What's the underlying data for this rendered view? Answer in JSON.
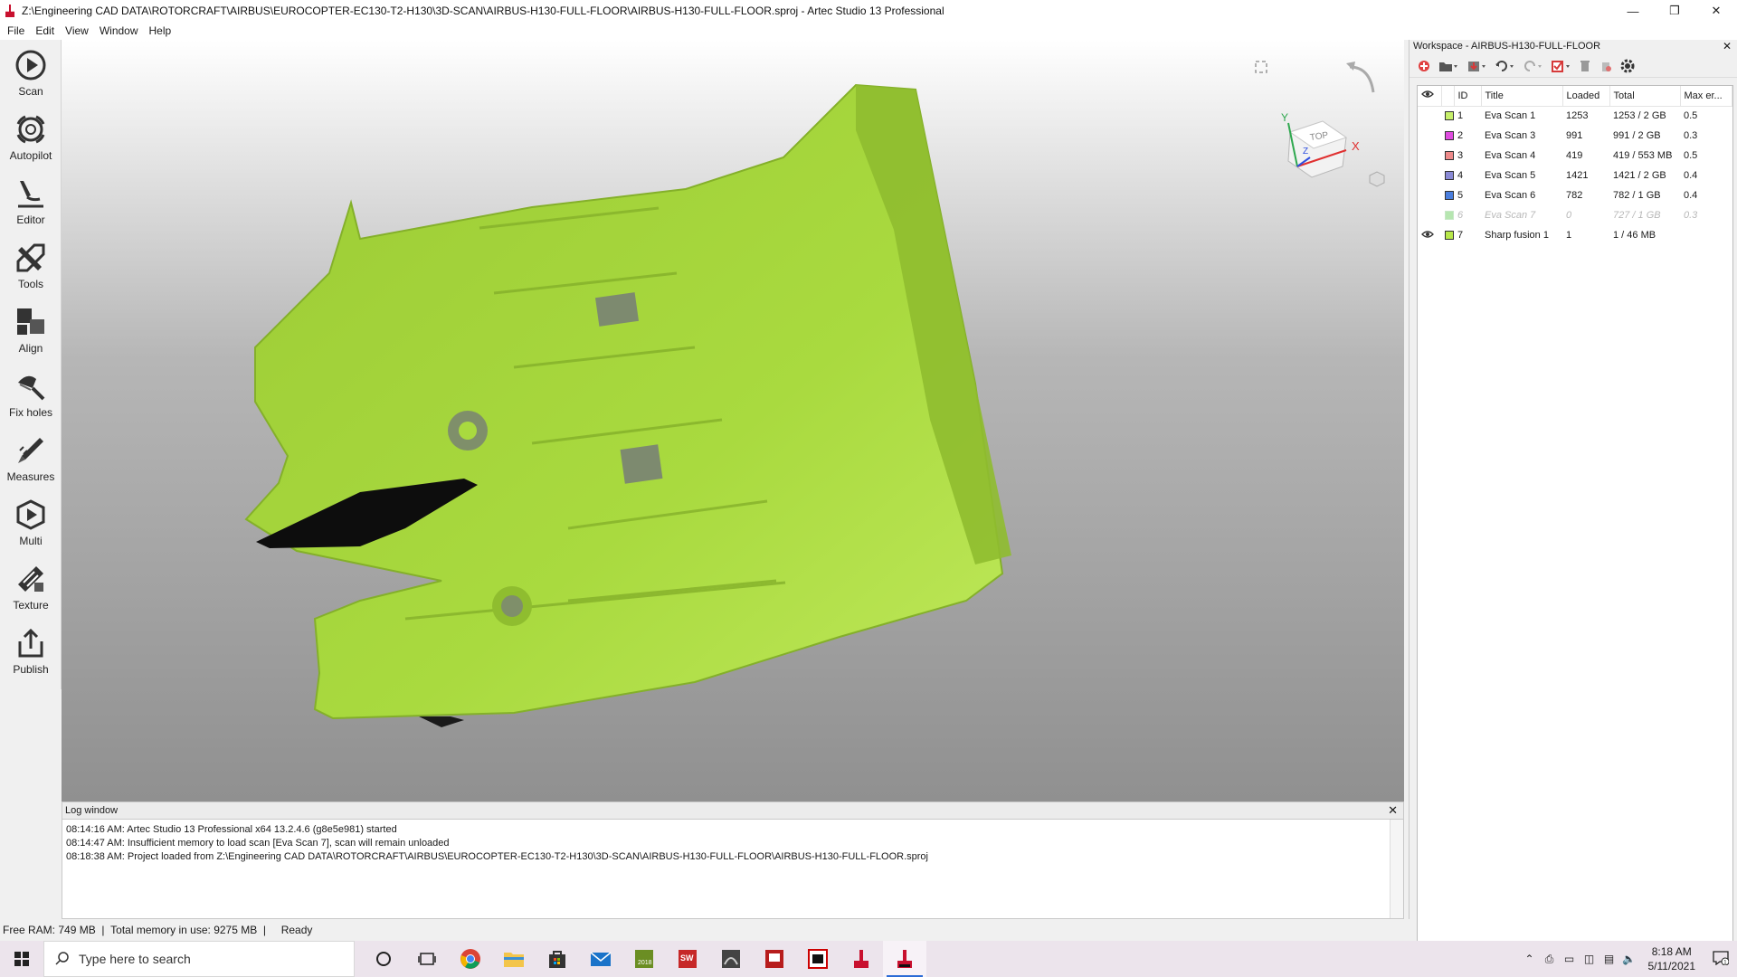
{
  "window": {
    "title": "Z:\\Engineering CAD DATA\\ROTORCRAFT\\AIRBUS\\EUROCOPTER-EC130-T2-H130\\3D-SCAN\\AIRBUS-H130-FULL-FLOOR\\AIRBUS-H130-FULL-FLOOR.sproj - Artec Studio 13 Professional"
  },
  "menu": {
    "items": [
      "File",
      "Edit",
      "View",
      "Window",
      "Help"
    ]
  },
  "toolbar": {
    "tools": [
      {
        "label": "Scan",
        "icon": "scan-icon"
      },
      {
        "label": "Autopilot",
        "icon": "autopilot-icon"
      },
      {
        "label": "Editor",
        "icon": "editor-icon"
      },
      {
        "label": "Tools",
        "icon": "tools-icon"
      },
      {
        "label": "Align",
        "icon": "align-icon"
      },
      {
        "label": "Fix holes",
        "icon": "fix-holes-icon"
      },
      {
        "label": "Measures",
        "icon": "measures-icon"
      },
      {
        "label": "Multi",
        "icon": "multi-icon"
      },
      {
        "label": "Texture",
        "icon": "texture-icon"
      },
      {
        "label": "Publish",
        "icon": "publish-icon"
      }
    ]
  },
  "viewport": {
    "orientation_cube_label": "TOP",
    "axis_x": "X",
    "axis_y": "Y",
    "axis_z": "Z",
    "model_color": "#a6d93c"
  },
  "log": {
    "title": "Log window",
    "lines": [
      "08:14:16 AM: Artec Studio 13 Professional x64 13.2.4.6 (g8e5e981) started",
      "08:14:47 AM: Insufficient memory to load scan [Eva Scan 7], scan will remain unloaded",
      "08:18:38 AM: Project loaded from Z:\\Engineering CAD DATA\\ROTORCRAFT\\AIRBUS\\EUROCOPTER-EC130-T2-H130\\3D-SCAN\\AIRBUS-H130-FULL-FLOOR\\AIRBUS-H130-FULL-FLOOR.sproj"
    ]
  },
  "status": {
    "free_ram": "Free RAM: 749 MB",
    "total_memory": "Total memory in use: 9275 MB",
    "state": "Ready"
  },
  "workspace": {
    "title": "Workspace - AIRBUS-H130-FULL-FLOOR",
    "columns": [
      "ID",
      "Title",
      "Loaded",
      "Total",
      "Max er..."
    ],
    "rows": [
      {
        "visible": false,
        "color": "#c7f06a",
        "id": "1",
        "title": "Eva Scan 1",
        "loaded": "1253",
        "total": "1253 / 2 GB",
        "max_err": "0.5",
        "muted": false
      },
      {
        "visible": false,
        "color": "#e04ce0",
        "id": "2",
        "title": "Eva Scan 3",
        "loaded": "991",
        "total": "991 / 2 GB",
        "max_err": "0.3",
        "muted": false
      },
      {
        "visible": false,
        "color": "#ee8a8a",
        "id": "3",
        "title": "Eva Scan 4",
        "loaded": "419",
        "total": "419 / 553 MB",
        "max_err": "0.5",
        "muted": false
      },
      {
        "visible": false,
        "color": "#8a8ad6",
        "id": "4",
        "title": "Eva Scan 5",
        "loaded": "1421",
        "total": "1421 / 2 GB",
        "max_err": "0.4",
        "muted": false
      },
      {
        "visible": false,
        "color": "#4a7ede",
        "id": "5",
        "title": "Eva Scan 6",
        "loaded": "782",
        "total": "782 / 1 GB",
        "max_err": "0.4",
        "muted": false
      },
      {
        "visible": false,
        "color": "#b6e6b0",
        "id": "6",
        "title": "Eva Scan 7",
        "loaded": "0",
        "total": "727 / 1 GB",
        "max_err": "0.3",
        "muted": true
      },
      {
        "visible": true,
        "color": "#b8e84a",
        "id": "7",
        "title": "Sharp fusion 1",
        "loaded": "1",
        "total": "1 / 46 MB",
        "max_err": "",
        "muted": false
      }
    ]
  },
  "taskbar": {
    "search_placeholder": "Type here to search",
    "apps": [
      "cortana-icon",
      "task-view-icon",
      "chrome-icon",
      "file-explorer-icon",
      "store-icon",
      "mail-icon",
      "solidworks-2018-icon",
      "solidworks-2018-red-icon",
      "solidworks-composer-icon",
      "solidworks-electrical-icon",
      "netflix-like-icon",
      "artec-icon",
      "artec-studio-icon"
    ],
    "time": "8:18 AM",
    "date": "5/11/2021",
    "notification_count": "1"
  }
}
